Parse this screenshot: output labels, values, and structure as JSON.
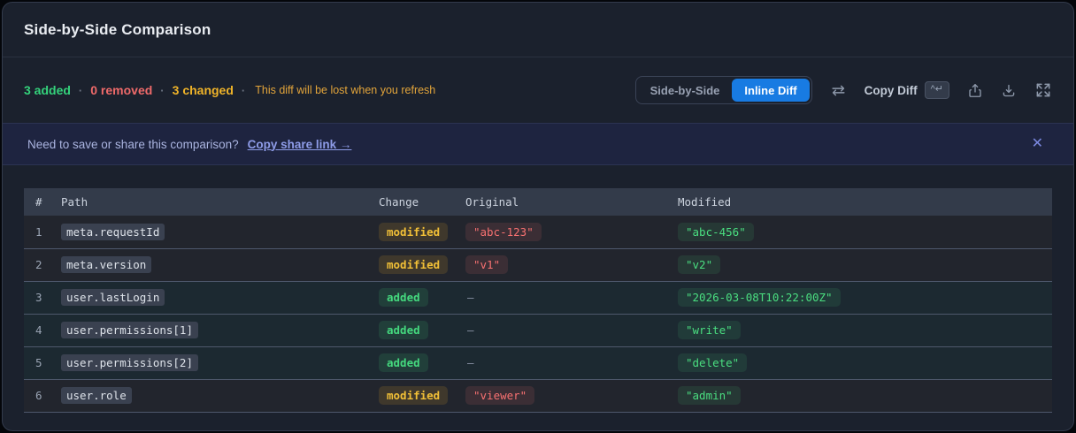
{
  "header": {
    "title": "Side-by-Side Comparison"
  },
  "toolbar": {
    "stats": {
      "added": "3 added",
      "removed": "0 removed",
      "changed": "3 changed",
      "dot": "·",
      "note": "This diff will be lost when you refresh"
    },
    "view_toggle": {
      "side_by_side_label": "Side-by-Side",
      "inline_diff_label": "Inline Diff",
      "active": "Inline Diff",
      "active_color": "#187be2"
    },
    "copy_diff": {
      "label": "Copy Diff",
      "shortcut": "^↵"
    },
    "icons": [
      "swap-icon",
      "share-icon",
      "download-icon",
      "expand-icon"
    ]
  },
  "banner": {
    "message": "Need to save or share this comparison?",
    "link": "Copy share link →",
    "close": "✕"
  },
  "table": {
    "columns": [
      "#",
      "Path",
      "Change",
      "Original",
      "Modified"
    ],
    "rows": [
      {
        "num": "1",
        "path": "meta.requestId",
        "change": "modified",
        "original": "\"abc-123\"",
        "modified": "\"abc-456\""
      },
      {
        "num": "2",
        "path": "meta.version",
        "change": "modified",
        "original": "\"v1\"",
        "modified": "\"v2\""
      },
      {
        "num": "3",
        "path": "user.lastLogin",
        "change": "added",
        "original": "—",
        "modified": "\"2026-03-08T10:22:00Z\""
      },
      {
        "num": "4",
        "path": "user.permissions[1]",
        "change": "added",
        "original": "—",
        "modified": "\"write\""
      },
      {
        "num": "5",
        "path": "user.permissions[2]",
        "change": "added",
        "original": "—",
        "modified": "\"delete\""
      },
      {
        "num": "6",
        "path": "user.role",
        "change": "modified",
        "original": "\"viewer\"",
        "modified": "\"admin\""
      }
    ]
  },
  "colors": {
    "added": "#34d27b",
    "removed": "#ef6a6a",
    "changed": "#f0b429",
    "accent_blue": "#187be2",
    "banner_bg": "#1e2440",
    "card_bg": "#1b212d"
  }
}
